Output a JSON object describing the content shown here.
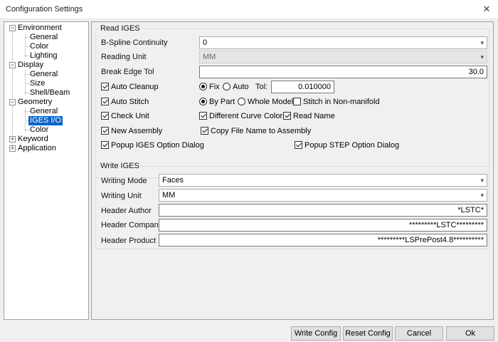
{
  "window": {
    "title": "Configuration Settings",
    "close_glyph": "✕"
  },
  "tree": {
    "expanded_glyph": "−",
    "collapsed_glyph": "+",
    "environment": "Environment",
    "env_general": "General",
    "env_color": "Color",
    "env_lighting": "Lighting",
    "display": "Display",
    "disp_general": "General",
    "disp_size": "Size",
    "disp_shellbeam": "Shell/Beam",
    "geometry": "Geometry",
    "geo_general": "General",
    "geo_iges": "IGES I/O",
    "geo_color": "Color",
    "keyword": "Keyword",
    "application": "Application"
  },
  "read_iges": {
    "title": "Read IGES",
    "bspline_label": "B-Spline Continuity",
    "bspline_value": "0",
    "reading_unit_label": "Reading Unit",
    "reading_unit_value": "MM",
    "break_edge_label": "Break Edge Tol",
    "break_edge_value": "30.0",
    "auto_cleanup": "Auto Cleanup",
    "fix": "Fix",
    "auto": "Auto",
    "tol_label": "Tol:",
    "tol_value": "0.010000",
    "auto_stitch": "Auto Stitch",
    "by_part": "By Part",
    "whole_model": "Whole Model",
    "stitch_nonmanifold": "Stitch in Non-manifold",
    "check_unit": "Check Unit",
    "diff_curve_colors": "Different Curve Colors",
    "read_name": "Read Name",
    "new_assembly": "New Assembly",
    "copy_file_name": "Copy File Name to Assembly",
    "popup_iges": "Popup IGES Option Dialog",
    "popup_step": "Popup STEP Option Dialog"
  },
  "write_iges": {
    "title": "Write IGES",
    "writing_mode_label": "Writing Mode",
    "writing_mode_value": "Faces",
    "writing_unit_label": "Writing Unit",
    "writing_unit_value": "MM",
    "header_author_label": "Header Author",
    "header_author_value": "*LSTC*",
    "header_company_label": "Header Company",
    "header_company_value": "*********LSTC*********",
    "header_product_label": "Header Product",
    "header_product_value": "*********LSPrePost4.8**********"
  },
  "combo_arrow": "▾",
  "buttons": {
    "write_config": "Write Config",
    "reset_config": "Reset Config",
    "cancel": "Cancel",
    "ok": "Ok"
  }
}
